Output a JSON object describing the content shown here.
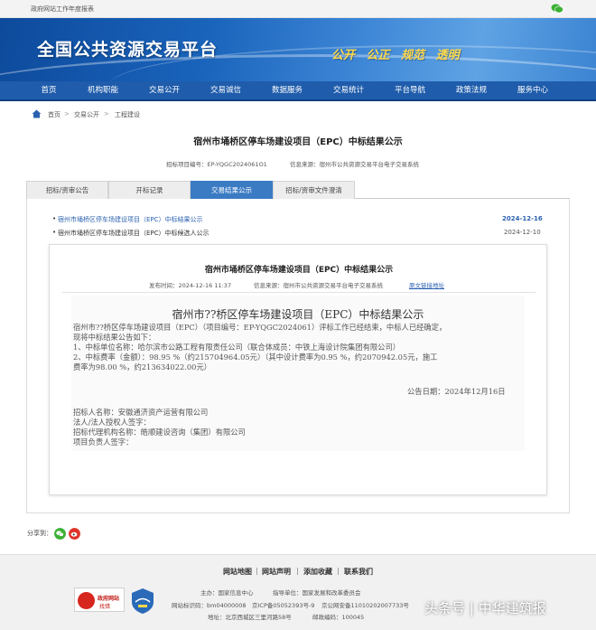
{
  "topbar": {
    "annual_report": "政府网站工作年度报表",
    "wechat_icon": "wechat-icon"
  },
  "banner": {
    "site_title": "全国公共资源交易平台",
    "slogan": "公开 公正 规范 透明"
  },
  "nav": {
    "items": [
      "首页",
      "机构职能",
      "交易公开",
      "交易诚信",
      "数据服务",
      "交易统计",
      "平台导航",
      "政策法规",
      "服务中心"
    ]
  },
  "breadcrumb": {
    "home": "首页",
    "level1": "交易公开",
    "level2": "工程建设",
    "sep": ">"
  },
  "page": {
    "title": "宿州市埇桥区停车场建设项目（EPC）中标结果公示",
    "project_no": "招标项目编号：EP-YQGC2024061O1",
    "info_source": "信息来源：宿州市公共资源交易平台电子交易系统"
  },
  "tabs": [
    "招标/资审公告",
    "开标记录",
    "交易结果公示",
    "招标/资审文件澄清"
  ],
  "list": [
    {
      "bullet": "•",
      "title": "宿州市埇桥区停车场建设项目（EPC）中标结果公示",
      "date": "2024-12-16"
    },
    {
      "bullet": "•",
      "title": "宿州市埇桥区停车场建设项目（EPC）中标候选人公示",
      "date": "2024-12-10"
    }
  ],
  "notice": {
    "title": "宿州市埇桥区停车场建设项目（EPC）中标结果公示",
    "publish_time": "发布时间：2024-12-16 11:37",
    "info_source": "信息来源：宿州市公共资源交易平台电子交易系统",
    "original_link": "原文链接地址"
  },
  "doc": {
    "title": "宿州市??桥区停车场建设项目（EPC）中标结果公示",
    "lines": [
      "宿州市??桥区停车场建设项目（EPC）（项目编号：EP-YQGC2024061）评标工作已经结束，中标人已经确定，",
      "现将中标结果公告如下：",
      "1、中标单位名称：哈尔滨市公路工程有限责任公司（联合体成员：中铁上海设计院集团有限公司）",
      "2、中标费率（金额）：98.95 %（约215704964.05元）（其中设计费率为0.95 %，约2070942.05元，施工",
      "费率为98.00 %，约213634022.00元）"
    ],
    "date": "公告日期：2024年12月16日",
    "sign_lines": [
      "招标人名称：安徽通济资产运营有限公司",
      "法人/法人授权人签字：",
      "招标代理机构名称：皓顺建设咨询（集团）有限公司",
      "项目负责人签字："
    ]
  },
  "share": {
    "label": "分享到：",
    "icons": [
      "wechat-share-icon",
      "weibo-share-icon"
    ]
  },
  "footer": {
    "links": [
      "网站地图",
      "网站声明",
      "添加收藏",
      "联系我们"
    ],
    "sep": "|",
    "host": "主办：国家信息中心",
    "guide": "指导单位：国家发展和改革委员会",
    "site_id": "网站标识码：bm04000008",
    "icp": "京ICP备05052393号-9",
    "police": "京公网安备11010202007733号",
    "address": "地址：北京西城区三里河路58号",
    "postcode": "邮政编码：100045",
    "gov_badge_line1": "政府网站",
    "gov_badge_line2": "找错"
  },
  "watermark": "头条号 | 中华建筑报",
  "colors": {
    "nav": "#1f5cab",
    "accent_link": "#2b62b0",
    "slogan": "#ffd94a",
    "active_tab": "#3b7bc4"
  }
}
